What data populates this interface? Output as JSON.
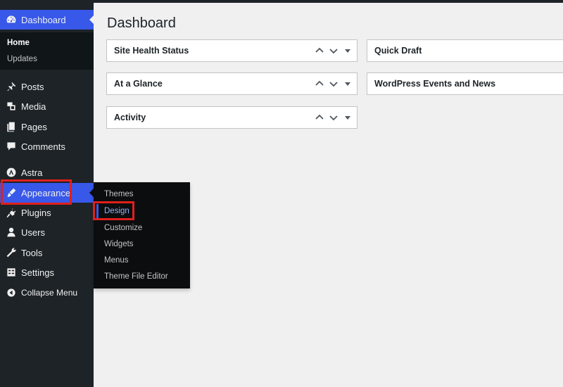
{
  "sidebar": {
    "dashboard_label": "Dashboard",
    "dashboard_sub": [
      "Home",
      "Updates"
    ],
    "items": [
      {
        "label": "Posts",
        "icon": "pin-icon"
      },
      {
        "label": "Media",
        "icon": "media-icon"
      },
      {
        "label": "Pages",
        "icon": "pages-icon"
      },
      {
        "label": "Comments",
        "icon": "comments-icon"
      },
      {
        "label": "Astra",
        "icon": "astra-icon"
      },
      {
        "label": "Appearance",
        "icon": "appearance-icon"
      },
      {
        "label": "Plugins",
        "icon": "plugins-icon"
      },
      {
        "label": "Users",
        "icon": "users-icon"
      },
      {
        "label": "Tools",
        "icon": "tools-icon"
      },
      {
        "label": "Settings",
        "icon": "settings-icon"
      },
      {
        "label": "Collapse Menu",
        "icon": "collapse-icon"
      }
    ]
  },
  "flyout": {
    "items": [
      "Themes",
      "Design",
      "Customize",
      "Widgets",
      "Menus",
      "Theme File Editor"
    ]
  },
  "main": {
    "title": "Dashboard",
    "panels": [
      {
        "title": "Site Health Status"
      },
      {
        "title": "Quick Draft"
      },
      {
        "title": "At a Glance"
      },
      {
        "title": "WordPress Events and News"
      },
      {
        "title": "Activity"
      }
    ]
  },
  "colors": {
    "sidebar_bg": "#1d2327",
    "active_blue": "#3858e9",
    "highlight_red": "#e0201d"
  }
}
